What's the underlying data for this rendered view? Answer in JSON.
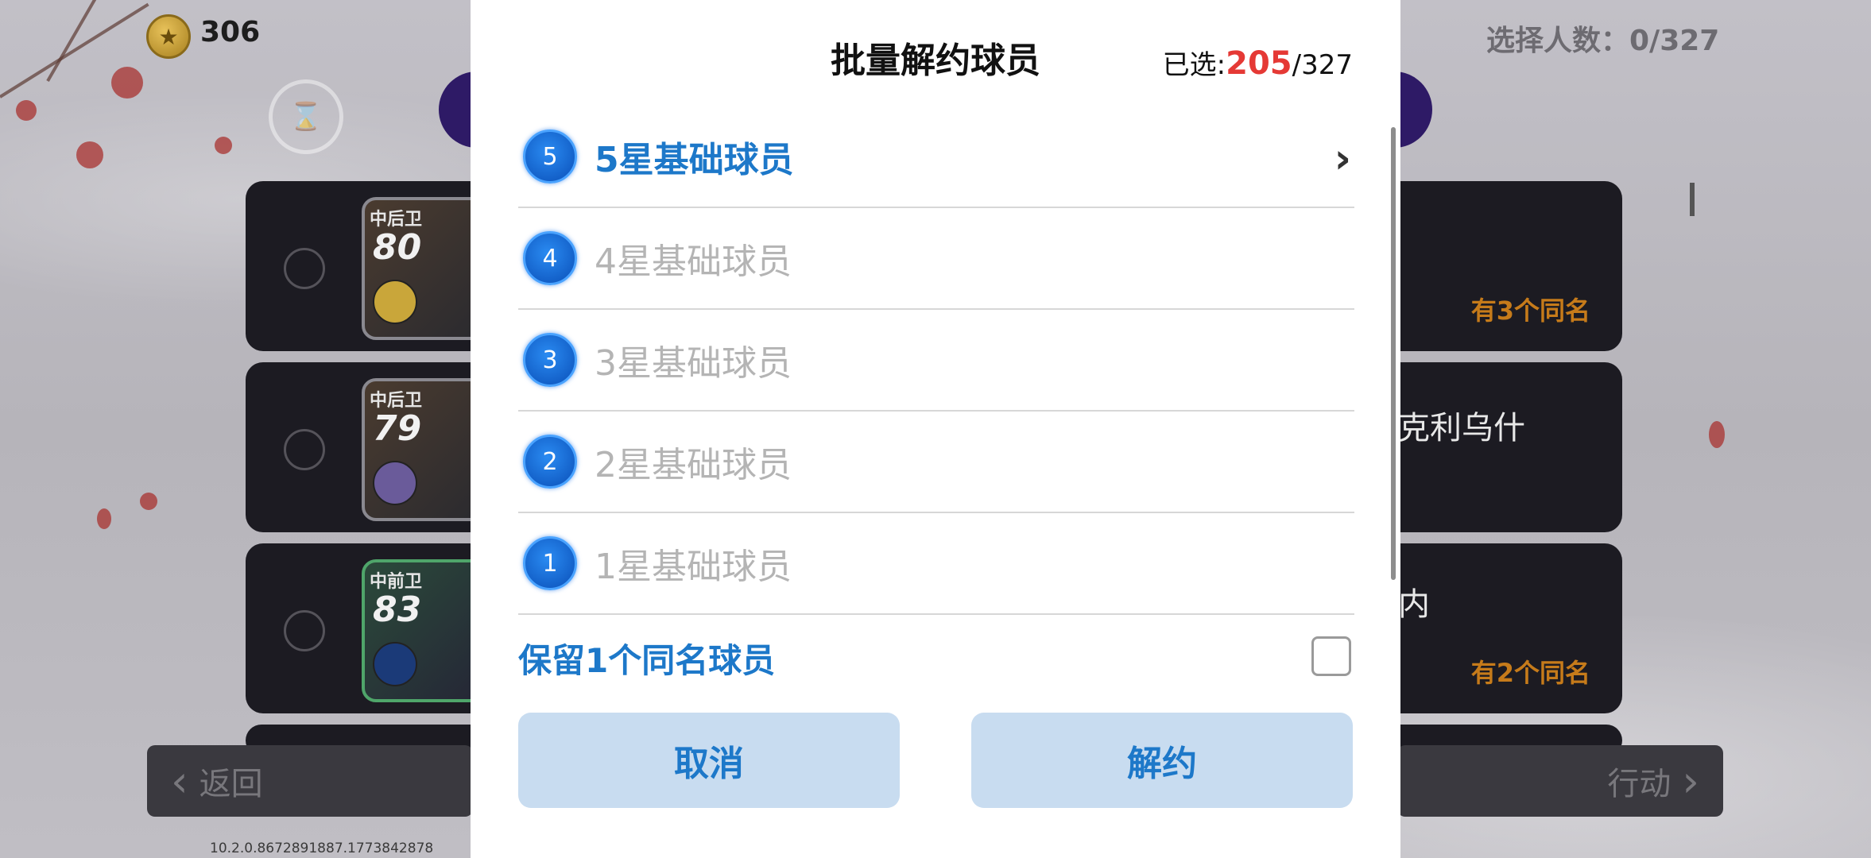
{
  "hud": {
    "coins": "306",
    "select_count": "选择人数：0/327"
  },
  "cards": [
    {
      "position": "中后卫",
      "rating": "80",
      "name": "",
      "duplicate": "有3个同名"
    },
    {
      "position": "中后卫",
      "rating": "79",
      "name": "克利乌什",
      "duplicate": ""
    },
    {
      "position": "中前卫",
      "rating": "83",
      "name": "内",
      "duplicate": "有2个同名"
    }
  ],
  "footer": {
    "back_label": "返回",
    "action_label": "行动",
    "version": "10.2.0.8672891887.1773842878"
  },
  "modal": {
    "title": "批量解约球员",
    "selected_prefix": "已选:",
    "selected_count": "205",
    "selected_total": "/327",
    "options": [
      {
        "stars": "5",
        "label": "5星基础球员",
        "active": true
      },
      {
        "stars": "4",
        "label": "4星基础球员",
        "active": false
      },
      {
        "stars": "3",
        "label": "3星基础球员",
        "active": false
      },
      {
        "stars": "2",
        "label": "2星基础球员",
        "active": false
      },
      {
        "stars": "1",
        "label": "1星基础球员",
        "active": false
      }
    ],
    "keep_label": "保留1个同名球员",
    "keep_checked": false,
    "cancel_label": "取消",
    "confirm_label": "解约"
  },
  "colors": {
    "accent_blue": "#1d78c9",
    "selected_red": "#e53935",
    "duplicate_orange": "#c67b1a"
  }
}
